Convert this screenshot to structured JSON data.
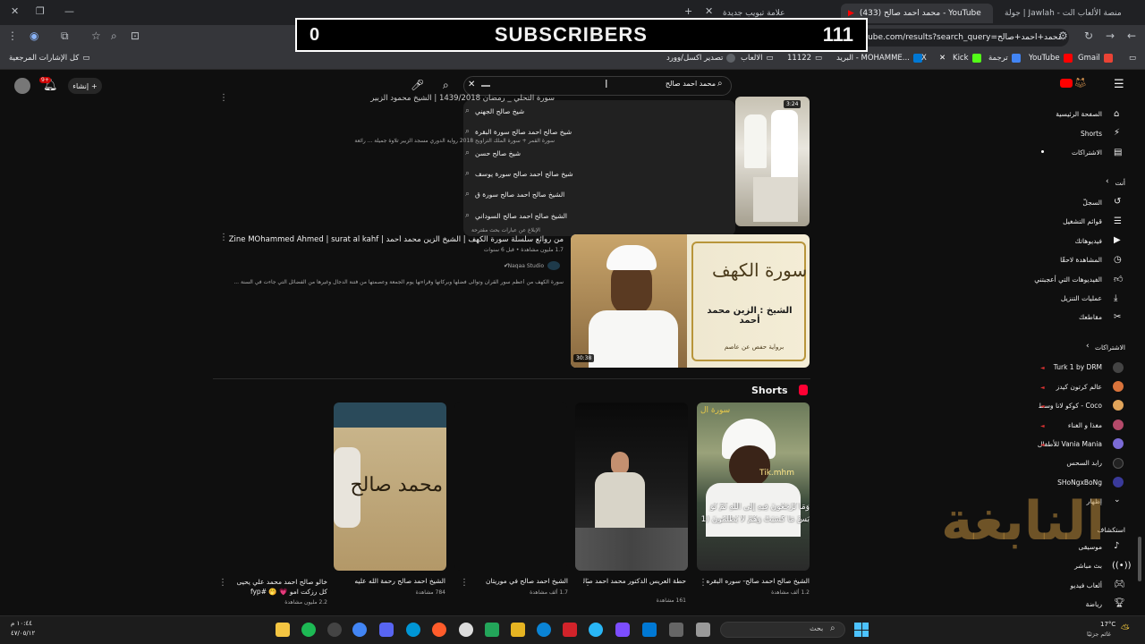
{
  "browser": {
    "tabs": [
      {
        "label": "جولة | Jawlah - منصة الألعاب الت",
        "active": false
      },
      {
        "label": "(433) محمد احمد صالح - YouTube",
        "active": true
      },
      {
        "label": "علامة تبويب جديدة",
        "active": false
      }
    ],
    "url": "youtube.com/results?search_query=محمد+احمد+صالح",
    "bookmarks": [
      "Gmail",
      "YouTube",
      "ترجمة",
      "Kick",
      "X",
      "البريد - MOHAMME...",
      "11122",
      "الالعاب",
      "تصدير اكسل/وورد",
      "كل الإشارات المرجعية"
    ]
  },
  "overlay": {
    "left": "0",
    "label": "SUBSCRIBERS",
    "right": "111"
  },
  "youtube": {
    "create_label": "إنشاء",
    "notif_count": "9+",
    "search": {
      "value": "محمد احمد صالح",
      "suggestions": [
        "شيخ صالح الجهني",
        "شيخ صالح احمد صالح سورة البقرة",
        "شيخ صالح حسن",
        "شيخ صالح احمد صالح سورة يوسف",
        "الشيخ صالح احمد صالح سورة ق",
        "الشيخ صالح احمد صالح السوداني"
      ],
      "report": "الإبلاغ عن عبارات بحث مقترحة"
    },
    "sidebar": {
      "main": [
        "الصفحة الرئيسية",
        "Shorts",
        "الاشتراكات"
      ],
      "you_header": "أنت",
      "you": [
        "السجلّ",
        "قوائم التشغيل",
        "فيديوهاتك",
        "المشاهدة لاحقًا",
        "الفيديوهات التي أعجبتني",
        "عمليات التنزيل",
        "مقاطعك"
      ],
      "subs_header": "الاشتراكات",
      "subs": [
        "Turk 1 by DRM",
        "عالم كرتون كيدز",
        "Coco - كوكو لانا وسط",
        "مغذا و الغناء",
        "Vania Mania للأطفال",
        "رابد السحس",
        "SHoNgxBoNg",
        "إظهار"
      ],
      "explore_header": "استكشاف",
      "explore": [
        "موسيقى",
        "بث مباشر",
        "ألعاب فيديو",
        "رياضة"
      ]
    },
    "results": [
      {
        "title": "من روائع سلسلة سورة الكهف | الشيخ الزين محمد أحمد | Al Zine MOhammed Ahmed | surat al kahf",
        "meta": "1.7 مليون مشاهدة • قبل 6 سنوات",
        "channel": "Naqaa Studio",
        "desc": "سورة الكهف من أعظم سور القرآن وتوالى فضلها وبركاتها وقراءتها يوم الجمعة وعصمتها من فتنة الدجال وغيرها من الفضائل التي جاءت في السنة ...",
        "duration": "30:38",
        "thumb_text": "سورة الكهف",
        "thumb_sub": "الشيخ : الزين محمد أحمد",
        "thumb_foot": "برواية حفص عن عاصم"
      }
    ],
    "top_partial": {
      "title": "سورة التحلي _ رمضان 1439/2018 | الشيخ محمود الزبير",
      "desc": "سورة القمر + سورة الملك التراويح 2018 رواية الدوري مسجد الزبير تلاوة جميلة ... رائعة",
      "duration": "3:24"
    },
    "shorts_label": "Shorts",
    "shorts": [
      {
        "title": "الشيخ صالح احمد صالح- سوره البقره",
        "views": "1.2 ألف مشاهدة"
      },
      {
        "title": "حطة العريس الدكتور محمد احمد صالح اليمني",
        "views": "161 مشاهدة"
      },
      {
        "title": "الشيخ احمد صالح في موريتان",
        "views": "1.7 ألف مشاهدة"
      },
      {
        "title": "الشيخ احمد صالح رحمة الله عليه",
        "views": "784 مشاهدة"
      },
      {
        "title": "خالو صالح احمد محمد علي يحيى كل رزكت امو 💗 🤭 #fyp #اكسبلور ...",
        "views": "2.2 مليون مشاهدة"
      }
    ],
    "short_thumb_text": "محمد صالح",
    "short_overlay_text": "وَمَا تُرْجَعُونَ فِيهِ إِلَى اللَّهِ ثُمَّ تُوَ",
    "short_overlay_text2": "بَسْ مَا كَسَبَتْ وَهُمْ لَا يُظْلَمُونَ (1",
    "short_brand": "Tik.mhm",
    "short_corner": "سورة ال"
  },
  "watermark": "النابغة",
  "taskbar": {
    "search_placeholder": "بحث",
    "clock_time": "١٠:٤٤ م",
    "clock_date": "٤٧/٠٥/١٢",
    "weather_temp": "17°C",
    "weather_desc": "غائم جزئيًا"
  }
}
